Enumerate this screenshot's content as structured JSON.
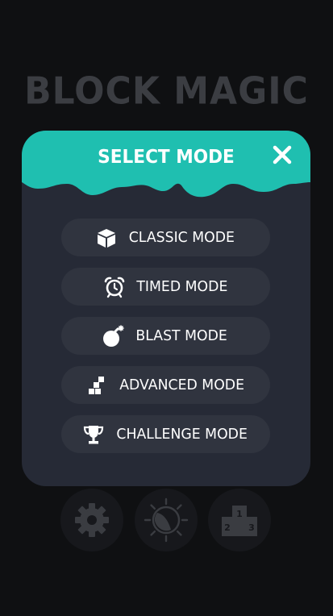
{
  "logo": {
    "text": "BLOCK MAGIC"
  },
  "modal": {
    "title": "SELECT MODE",
    "close_icon": "close-icon",
    "accent_color": "#1fbfb0",
    "modes": [
      {
        "label": "CLASSIC MODE",
        "icon": "cube-icon"
      },
      {
        "label": "TIMED MODE",
        "icon": "alarm-clock-icon"
      },
      {
        "label": "BLAST MODE",
        "icon": "bomb-icon"
      },
      {
        "label": "ADVANCED MODE",
        "icon": "blocks-icon"
      },
      {
        "label": "CHALLENGE MODE",
        "icon": "trophy-icon"
      }
    ]
  },
  "bottom_bar": {
    "settings_icon": "gear-icon",
    "theme_icon": "theme-sun-moon-icon",
    "leaderboard_icon": "podium-icon",
    "podium_labels": [
      "1",
      "2",
      "3"
    ]
  }
}
